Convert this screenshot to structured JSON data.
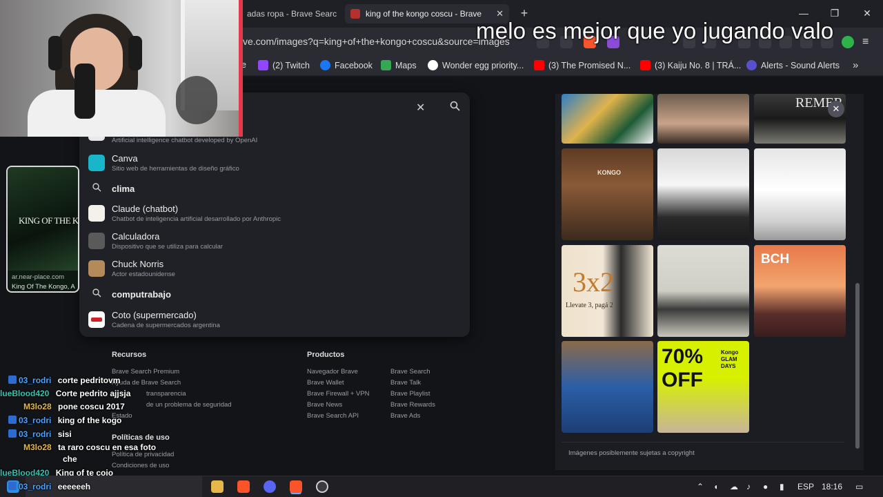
{
  "browser": {
    "tabs": [
      {
        "title": "adas ropa - Brave Search",
        "active": false
      },
      {
        "title": "king of the kongo coscu - Brave",
        "active": true
      }
    ],
    "url": "ve.com/images?q=king+of+the+kongo+coscu&source=images",
    "bookmarks": [
      "(2) Twitch",
      "Facebook",
      "Maps",
      "Wonder egg priority...",
      "(3) The Promised N...",
      "(3) Kaiju No. 8 | TRÁ...",
      "Alerts - Sound Alerts"
    ],
    "bookmark_left": "e"
  },
  "overlay_title": "melo es mejor que yo jugando valo",
  "search_suggestions": [
    {
      "title": "",
      "subtitle": "Artificial intelligence chatbot developed by OpenAI",
      "kind": "entity"
    },
    {
      "title": "Canva",
      "subtitle": "Sitio web de herramientas de diseño gráfico",
      "kind": "entity"
    },
    {
      "title": "clima",
      "kind": "query"
    },
    {
      "title": "Claude (chatbot)",
      "subtitle": "Chatbot de inteligencia artificial desarrollado por Anthropic",
      "kind": "entity"
    },
    {
      "title": "Calculadora",
      "subtitle": "Dispositivo que se utiliza para calcular",
      "kind": "entity"
    },
    {
      "title": "Chuck Norris",
      "subtitle": "Actor estadounidense",
      "kind": "entity"
    },
    {
      "title": "computrabajo",
      "kind": "query"
    },
    {
      "title": "Coto (supermercado)",
      "subtitle": "Cadena de supermercados argentina",
      "kind": "entity"
    }
  ],
  "preview": {
    "image_text": "KING OF THE K",
    "source": "ar.near-place.com",
    "desc": "King Of The Kongo, A"
  },
  "images": {
    "captions": [
      "KONGO",
      "3x2",
      "Llevate 3, pagá 2",
      "BCH",
      "70% OFF",
      "Kongo GLAM DAYS",
      "REMER"
    ],
    "copyright": "Imágenes posiblemente sujetas a copyright"
  },
  "footer": {
    "recursos": {
      "heading": "Recursos",
      "links": [
        "Brave Search Premium",
        "Ayuda de Brave Search",
        "transparencia",
        "de un problema de seguridad",
        "Estado"
      ]
    },
    "productos": {
      "heading": "Productos",
      "col1": [
        "Navegador Brave",
        "Brave Wallet",
        "Brave Firewall + VPN",
        "Brave News",
        "Brave Search API"
      ],
      "col2": [
        "Brave Search",
        "Brave Talk",
        "Brave Playlist",
        "Brave Rewards",
        "Brave Ads"
      ]
    },
    "politicas": {
      "heading": "Políticas de uso",
      "links": [
        "Política de privacidad",
        "Condiciones de uso"
      ]
    }
  },
  "chat": [
    {
      "user": "03_rodri",
      "msg": "corte pedritovm",
      "color": "#4aa3ff",
      "badge": true
    },
    {
      "user": "lueBlood420",
      "msg": "Corte pedrito ajjsja",
      "color": "#34c3b0",
      "badge": false
    },
    {
      "user": "M3lo28",
      "msg": "pone coscu 2017",
      "color": "#e3b64a",
      "badge": false
    },
    {
      "user": "03_rodri",
      "msg": "king of the kogo",
      "color": "#4aa3ff",
      "badge": true
    },
    {
      "user": "03_rodri",
      "msg": "sisi",
      "color": "#4aa3ff",
      "badge": true
    },
    {
      "user": "M3lo28",
      "msg": "ta raro coscu en esa foto",
      "color": "#e3b64a",
      "badge": false
    },
    {
      "user": "",
      "msg": "che",
      "color": "#e3b64a",
      "badge": false
    },
    {
      "user": "lueBlood420",
      "msg": "King of te cojo",
      "color": "#34c3b0",
      "badge": false
    },
    {
      "user": "03_rodri",
      "msg": "eeeeeeh",
      "color": "#4aa3ff",
      "badge": true
    }
  ],
  "taskbar": {
    "lang": "ESP",
    "time": "18:16"
  },
  "colors": {
    "accent": "#fb542b",
    "page_bg": "#131418",
    "panel": "#202127"
  }
}
